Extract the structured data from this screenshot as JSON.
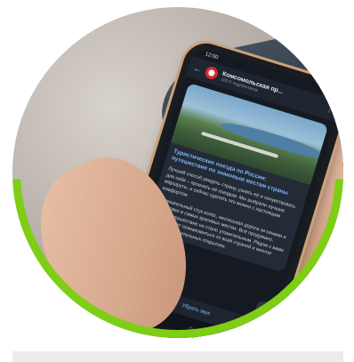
{
  "phone": {
    "status_time": "12:00",
    "status_icons": "▾ ▮",
    "channel_name": "Комсомольская пр...",
    "channel_subtitle": "100 К подписчиков",
    "post_title": "Туристические поезда по России: путешествие по знаковым местам страны",
    "post_body_1": "Лучший способ увидеть страну, узнать её и почувствовать для себя – проехать её поездом. Мы выбрали лучшие маршруты, и сейчас сделать это можно с настоящим комфортом.",
    "post_body_2": "Увлекательный стук колёс, неспешная дорога за окнами и остановки в самых красивых местах. Всё продумано, чтобы путешествие не стало утомительным. Рядом с вами можно будет познакомиться со всей страной и многое узнать в удивительных открытиях.",
    "bottom_action": "Убрать звук",
    "nav_icons": {
      "menu": "|||",
      "home": "○",
      "back": "<"
    }
  },
  "accent_color": "#7dce14",
  "icons": {
    "back": "back-arrow-icon",
    "menu": "more-vert-icon",
    "scroll_down": "chevron-down-icon"
  }
}
